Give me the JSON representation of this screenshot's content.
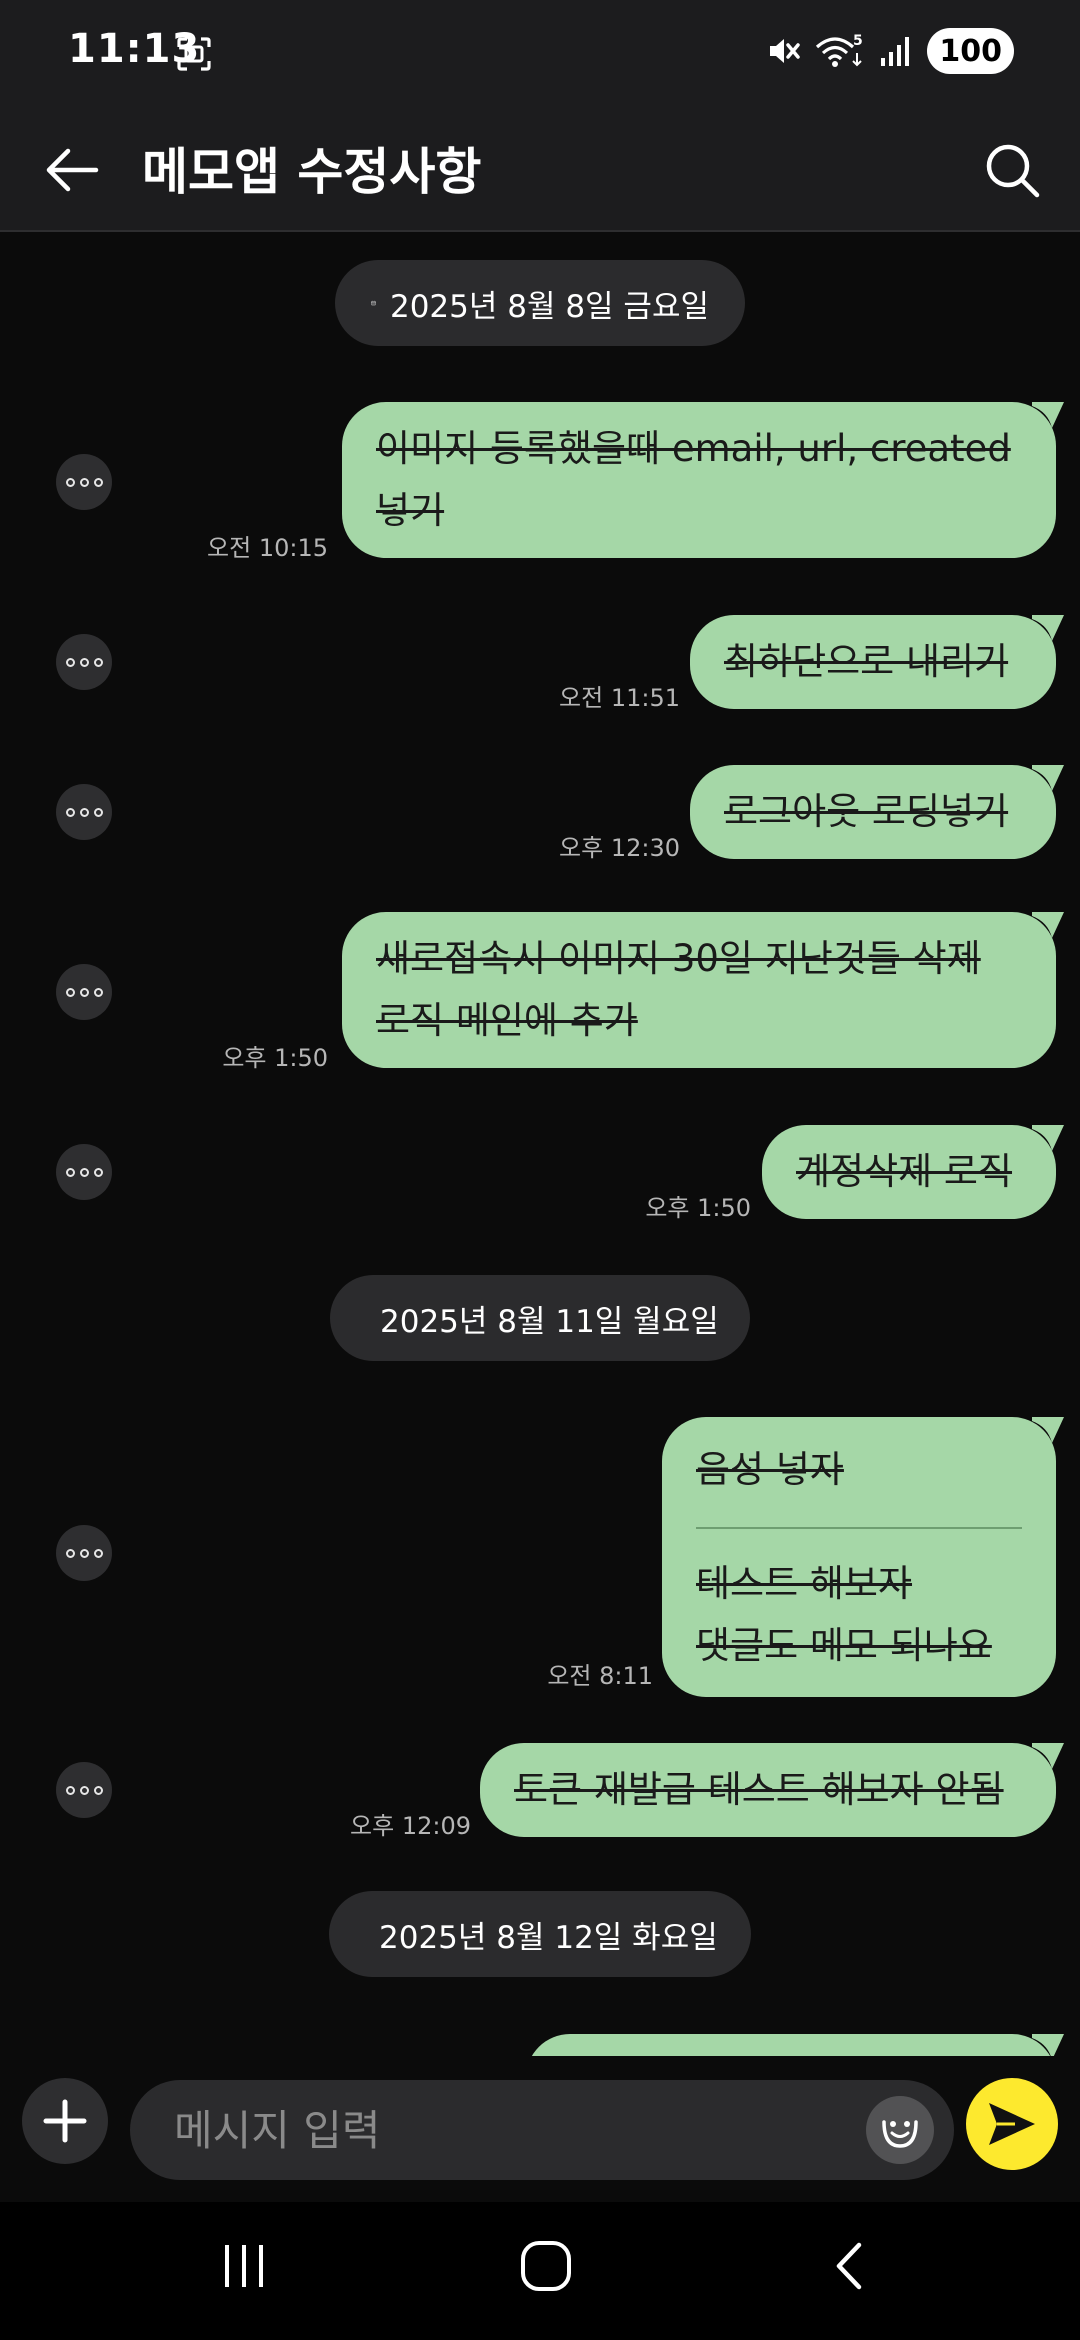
{
  "status_bar": {
    "time": "11:13",
    "wifi_badge": "5",
    "battery": "100"
  },
  "header": {
    "title": "메모앱 수정사항",
    "back_icon": "arrow-left-icon",
    "search_icon": "search-icon"
  },
  "chat": {
    "dates": [
      "2025년 8월 8일 금요일",
      "2025년 8월 11일 월요일",
      "2025년 8월 12일 화요일"
    ],
    "messages": [
      {
        "text": "이미지 등록했을때 email, url, created\n넣기",
        "time": "오전 10:15",
        "struck": true
      },
      {
        "text": "최하단으로 내리기",
        "time": "오전 11:51",
        "struck": true
      },
      {
        "text": "로그아웃 로딩넣기",
        "time": "오후 12:30",
        "struck": true
      },
      {
        "text": "새로접속시 이미지 30일 지난것들 삭제\n로직 메인에 추가",
        "time": "오후 1:50",
        "struck": true
      },
      {
        "text": "계정삭제 로직",
        "time": "오후 1:50",
        "struck": true
      },
      {
        "text": "음성 넣자",
        "text_after_divider": "테스트 해보자\n댓글도 메모 되나요",
        "time": "오전 8:11",
        "struck": true
      },
      {
        "text": "토큰 재발급 테스트 해보자 안됨",
        "time": "오후 12:09",
        "struck": true
      }
    ],
    "colors": {
      "bubble": "#a5d7a7",
      "date_chip": "#2b2b2d",
      "background": "#0b0b0b"
    }
  },
  "input": {
    "placeholder": "메시지 입력",
    "value": "",
    "send_color": "#fde92e"
  },
  "nav_bar": {
    "icons": [
      "recent-apps-icon",
      "home-icon",
      "back-icon"
    ]
  }
}
